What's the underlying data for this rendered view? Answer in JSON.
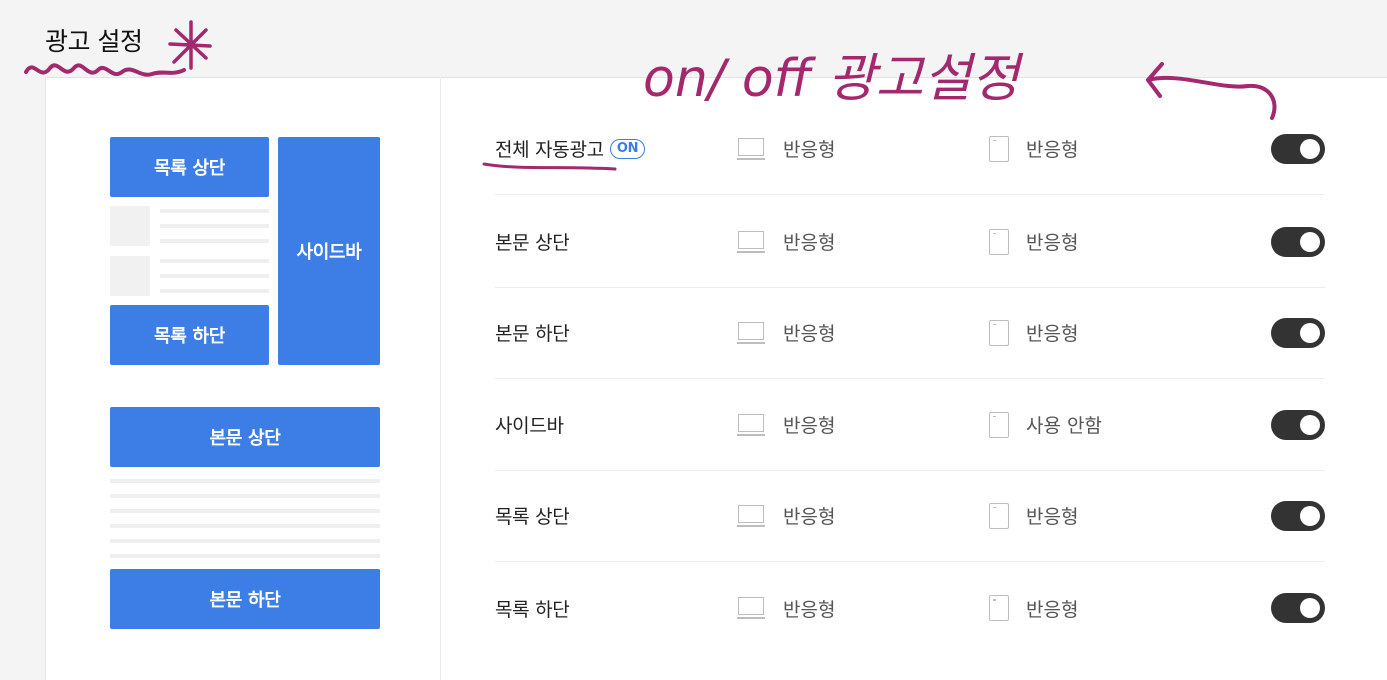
{
  "page": {
    "title": "광고 설정"
  },
  "preview": {
    "list_top": "목록 상단",
    "list_bottom": "목록 하단",
    "sidebar": "사이드바",
    "body_top": "본문 상단",
    "body_bottom": "본문 하단"
  },
  "rows": [
    {
      "name": "전체 자동광고",
      "badge": "ON",
      "pc": "반응형",
      "mobile": "반응형",
      "enabled": true
    },
    {
      "name": "본문 상단",
      "pc": "반응형",
      "mobile": "반응형",
      "enabled": true
    },
    {
      "name": "본문 하단",
      "pc": "반응형",
      "mobile": "반응형",
      "enabled": true
    },
    {
      "name": "사이드바",
      "pc": "반응형",
      "mobile": "사용 안함",
      "enabled": true
    },
    {
      "name": "목록 상단",
      "pc": "반응형",
      "mobile": "반응형",
      "enabled": true
    },
    {
      "name": "목록 하단",
      "pc": "반응형",
      "mobile": "반응형",
      "enabled": true
    }
  ],
  "annotation": {
    "text": "on/ off 광고설정"
  },
  "colors": {
    "accent": "#3d7ee6",
    "toggle_on": "#333333",
    "annotation": "#a3286e"
  },
  "icons": {
    "pc": "monitor-icon",
    "mobile": "phone-icon"
  }
}
